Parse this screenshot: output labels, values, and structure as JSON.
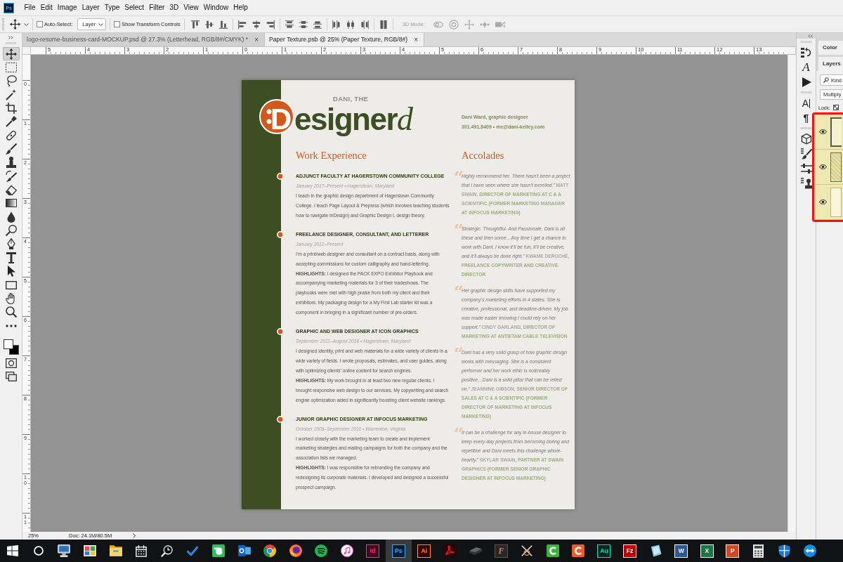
{
  "app": {
    "logo": "Ps"
  },
  "menu": [
    "File",
    "Edit",
    "Image",
    "Layer",
    "Type",
    "Select",
    "Filter",
    "3D",
    "View",
    "Window",
    "Help"
  ],
  "options_bar": {
    "auto_select": {
      "label": "Auto-Select:",
      "checked": false
    },
    "target": "Layer",
    "transform_controls": {
      "label": "Show Transform Controls",
      "checked": false
    },
    "mode_3d": {
      "label": "3D Mode:",
      "disabled": true
    }
  },
  "tabs": [
    {
      "label": "logo-resume-business-card-MOCKUP.psd @ 27.3% (Letterhead, RGB/8#/CMYK) *",
      "close": "×",
      "selected": false
    },
    {
      "label": "Paper Texture.psb @ 25% (Paper Texture, RGB/8#)",
      "close": "×",
      "selected": true
    }
  ],
  "tools": {
    "items": [
      {
        "kind": "move",
        "selected": true
      },
      {
        "kind": "marquee",
        "selected": false
      },
      {
        "kind": "lasso",
        "selected": false
      },
      {
        "kind": "wand",
        "selected": false
      },
      {
        "kind": "crop",
        "selected": false
      },
      {
        "kind": "eyedropper",
        "selected": false
      },
      {
        "kind": "healing",
        "selected": false
      },
      {
        "kind": "brush",
        "selected": false
      },
      {
        "kind": "stamp",
        "selected": false
      },
      {
        "kind": "history",
        "selected": false
      },
      {
        "kind": "eraser",
        "selected": false
      },
      {
        "kind": "gradient",
        "selected": false
      },
      {
        "kind": "blur",
        "selected": false
      },
      {
        "kind": "dodge",
        "selected": false
      },
      {
        "kind": "pen",
        "selected": false
      },
      {
        "kind": "type",
        "selected": false
      },
      {
        "kind": "path",
        "selected": false
      },
      {
        "kind": "shape",
        "selected": false
      },
      {
        "kind": "hand",
        "selected": false
      },
      {
        "kind": "zoom",
        "selected": false
      },
      {
        "kind": "more",
        "selected": false
      }
    ]
  },
  "rulers": {
    "horizontal": [
      "5",
      "4",
      "3",
      "2",
      "1",
      "0",
      "1",
      "2",
      "3",
      "4",
      "5",
      "6",
      "7",
      "8",
      "9",
      "10",
      "11",
      "12",
      "13"
    ],
    "vertical": [
      "0",
      "1",
      "2",
      "3",
      "4",
      "5",
      "6",
      "7",
      "8",
      "9",
      "10",
      "11"
    ]
  },
  "document": {
    "logo": {
      "tagline": "DANI, THE",
      "initial": "D",
      "body": "esigner",
      "tail": "d"
    },
    "contact": {
      "name": "Dani Ward, graphic designer",
      "phone": "301.491.8409",
      "separator": "•",
      "email": "me@dani-kelley.com"
    },
    "experience": {
      "heading": "Work Experience",
      "jobs": [
        {
          "title": "ADJUNCT FACULTY AT HAGERSTOWN COMMUNITY COLLEGE",
          "dates": "January 2017–Present • Hagerstown, Maryland",
          "description": "I teach in the graphic design department of Hagerstown Community College. I teach Page Layout & Prepress (which involves teaching students how to navigate InDesign) and Graphic Design I, design theory."
        },
        {
          "title": "FREELANCE DESIGNER, CONSULTANT, AND LETTERER",
          "dates": "January 2012–Present",
          "description": "I’m a print/web designer and consultant on a contract basis, along with accepting commissions for custom calligraphy and hand-lettering.",
          "highlights": "**HIGHLIGHTS:** I designed the PACK EXPO Exhibitor Playbook and accompanying marketing materials for 3 of their tradeshows. The playbooks were met with high praise from both my client and their exhibitors. My packaging design for a My First Lab starter kit was a component in bringing in a significant number of pre-orders."
        },
        {
          "title": "GRAPHIC AND WEB DESIGNER AT ICON GRAPHICS",
          "dates": "September 2011–August 2016 • Hagerstown, Maryland",
          "description": "I designed identity, print and web materials for a wide variety of clients in a wide variety of fields. I wrote proposals, estimates, and user guides, along with optimizing clients’ online content for search engines.",
          "highlights": "**HIGHLIGHTS:** My work brought in at least two new regular clients. I brought responsive web design to our services. My copywriting and search engine optimization aided in significantly boosting client website rankings."
        },
        {
          "title": "JUNIOR GRAPHIC DESIGNER AT INFOCUS MARKETING",
          "dates": "October 2009–September 2011 • Warrenton, Virginia",
          "description": "I worked closely with the marketing team to create and implement marketing strategies and mailing campaigns for both the company and the association lists we managed.",
          "highlights": "**HIGHLIGHTS:** I was responsible for rebranding the company and redesigning its corporate materials. I developed and designed a successful prospect campaign."
        }
      ]
    },
    "accolades": {
      "heading": "Accolades",
      "quotes": [
        {
          "mark": "“",
          "text": "Highly recommend her. There hasn’t been a project that I have seen where she hasn’t excelled.”",
          "name": "MATT SWAIN,",
          "role": "DIRECTOR OF MARKETING AT C & A SCIENTIFIC (FORMER MARKETING MANAGER AT INFOCUS MARKETING)"
        },
        {
          "mark": "“",
          "text": "Strategic. Thoughtful. And Passionate. Dani is all these and then some…Any time I get a chance to work with Dani, I know it’ll be fun, it’ll be creative, and it’ll always be done right.”",
          "name": "KWAME DEROCHÉ,",
          "role": "FREELANCE COPYWRITER AND CREATIVE DIRECTOR"
        },
        {
          "mark": "“",
          "text": "Her graphic design skills have supported my company’s marketing efforts in 4 states. She is creative, professional, and deadline-driven. My job was made easier knowing I could rely on her support.”",
          "name": "CINDY GARLAND,",
          "role": "DIRECTOR OF MARKETING AT ANTIETAM CABLE TELEVISION"
        },
        {
          "mark": "“",
          "text": "Dani has a very solid grasp of how graphic design works with messaging. She is a consistent performer and her work ethic is noticeably positive…Dani is a solid pillar that can be relied on.”",
          "name": "JEANNINE GIBSON,",
          "role": "SENIOR DIRECTOR OF SALES AT C & A SCIENTIFIC (FORMER DIRECTOR OF MARKETING AT INFOCUS MARKETING)"
        },
        {
          "mark": "“",
          "text": "It can be a challenge for any in-house designer to keep every-day projects from becoming boring and repetitive and Dani meets this challenge whole-heartly.”",
          "name": "SKYLAR SWAIN,",
          "role": "PARTNER AT SWAIN GRAPHICS (FORMER SENIOR GRAPHIC DESIGNER AT INFOCUS MARKETING)"
        }
      ]
    }
  },
  "status_bar": {
    "zoom": "25%",
    "doc": "Doc: 24.1M/80.5M"
  },
  "dock": {
    "buttons": [
      {
        "kind": "history"
      },
      {
        "kind": "styles",
        "label": "A"
      },
      {
        "kind": "actions"
      },
      {
        "kind": "character",
        "label": "A"
      },
      {
        "kind": "paragraph",
        "label": "¶"
      },
      {
        "kind": "model"
      },
      {
        "kind": "brushes"
      },
      {
        "kind": "adjustments"
      },
      {
        "kind": "clone"
      }
    ]
  },
  "panels": {
    "tabs": [
      "Color",
      "Layers"
    ],
    "filter": "Kind",
    "blend_mode": "Multiply",
    "lock_label": "Lock:",
    "layers": [
      {
        "kind": "frame",
        "visible": true
      },
      {
        "kind": "pattern",
        "visible": true
      },
      {
        "kind": "plain",
        "visible": true
      }
    ]
  },
  "taskbar": {
    "items": [
      {
        "kind": "start",
        "selected": false
      },
      {
        "kind": "search",
        "selected": false
      },
      {
        "kind": "remote",
        "selected": false
      },
      {
        "kind": "photos",
        "selected": false
      },
      {
        "kind": "folder",
        "selected": false
      },
      {
        "kind": "calendar",
        "selected": false
      },
      {
        "kind": "tools",
        "selected": false
      },
      {
        "kind": "check",
        "selected": false
      },
      {
        "kind": "note",
        "selected": false
      },
      {
        "kind": "mail",
        "selected": false
      },
      {
        "kind": "wheel",
        "selected": false
      },
      {
        "kind": "fox",
        "selected": false
      },
      {
        "kind": "waves",
        "selected": false
      },
      {
        "kind": "music",
        "selected": false
      },
      {
        "kind": "tile-rose",
        "label": "Id",
        "selected": false
      },
      {
        "kind": "tile-sky",
        "label": "Ps",
        "selected": true
      },
      {
        "kind": "tile-amber",
        "label": "Ai",
        "selected": false
      },
      {
        "kind": "swirl",
        "selected": false
      },
      {
        "kind": "slab",
        "selected": false
      },
      {
        "kind": "tile-italic",
        "label": "F",
        "selected": false
      },
      {
        "kind": "crossed",
        "selected": false
      },
      {
        "kind": "c-green",
        "selected": false
      },
      {
        "kind": "c-orange",
        "selected": false
      },
      {
        "kind": "tile-teal",
        "label": "Au",
        "selected": false
      },
      {
        "kind": "tile-red",
        "label": "Fz",
        "selected": false
      },
      {
        "kind": "glass",
        "selected": false
      },
      {
        "kind": "tile-blue",
        "label": "W",
        "selected": false
      },
      {
        "kind": "tile-green",
        "label": "X",
        "selected": false
      },
      {
        "kind": "tile-orange",
        "label": "P",
        "selected": false
      },
      {
        "kind": "calculator",
        "selected": false
      },
      {
        "kind": "shield",
        "selected": false
      },
      {
        "kind": "arrows",
        "selected": false
      }
    ]
  }
}
